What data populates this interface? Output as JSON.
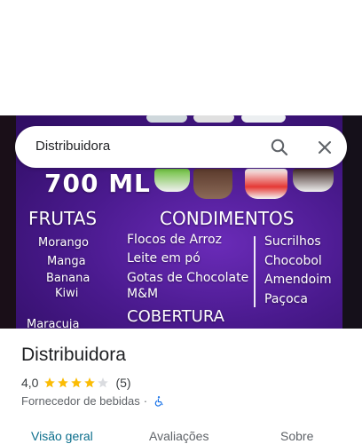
{
  "search": {
    "query": "Distribuidora"
  },
  "photo": {
    "heading_size": "700 ML",
    "col_frutas_title": "FRUTAS",
    "col_condimentos_title": "CONDIMENTOS",
    "frutas": [
      "Morango",
      "Manga",
      "Banana",
      "Kiwi"
    ],
    "condimentos_a": [
      "Flocos de Arroz",
      "Leite em pó",
      "Gotas de Chocolate",
      "M&M"
    ],
    "condimentos_b": [
      "Sucrilhos",
      "Chocobol",
      "Amendoim",
      "Paçoca"
    ],
    "cobertura_title": "COBERTURA",
    "bottom_partial": "Maracuja"
  },
  "place": {
    "name": "Distribuidora",
    "rating": "4,0",
    "rating_value": 4.0,
    "review_count": "(5)",
    "category": "Fornecedor de bebidas",
    "separator": "·"
  },
  "tabs": [
    {
      "label": "Visão geral",
      "active": true
    },
    {
      "label": "Avaliações",
      "active": false
    },
    {
      "label": "Sobre",
      "active": false
    }
  ],
  "colors": {
    "accent": "#0b6e8c",
    "star": "#fbbc04",
    "star_empty": "#dadce0",
    "a11y_icon": "#1a73e8"
  }
}
